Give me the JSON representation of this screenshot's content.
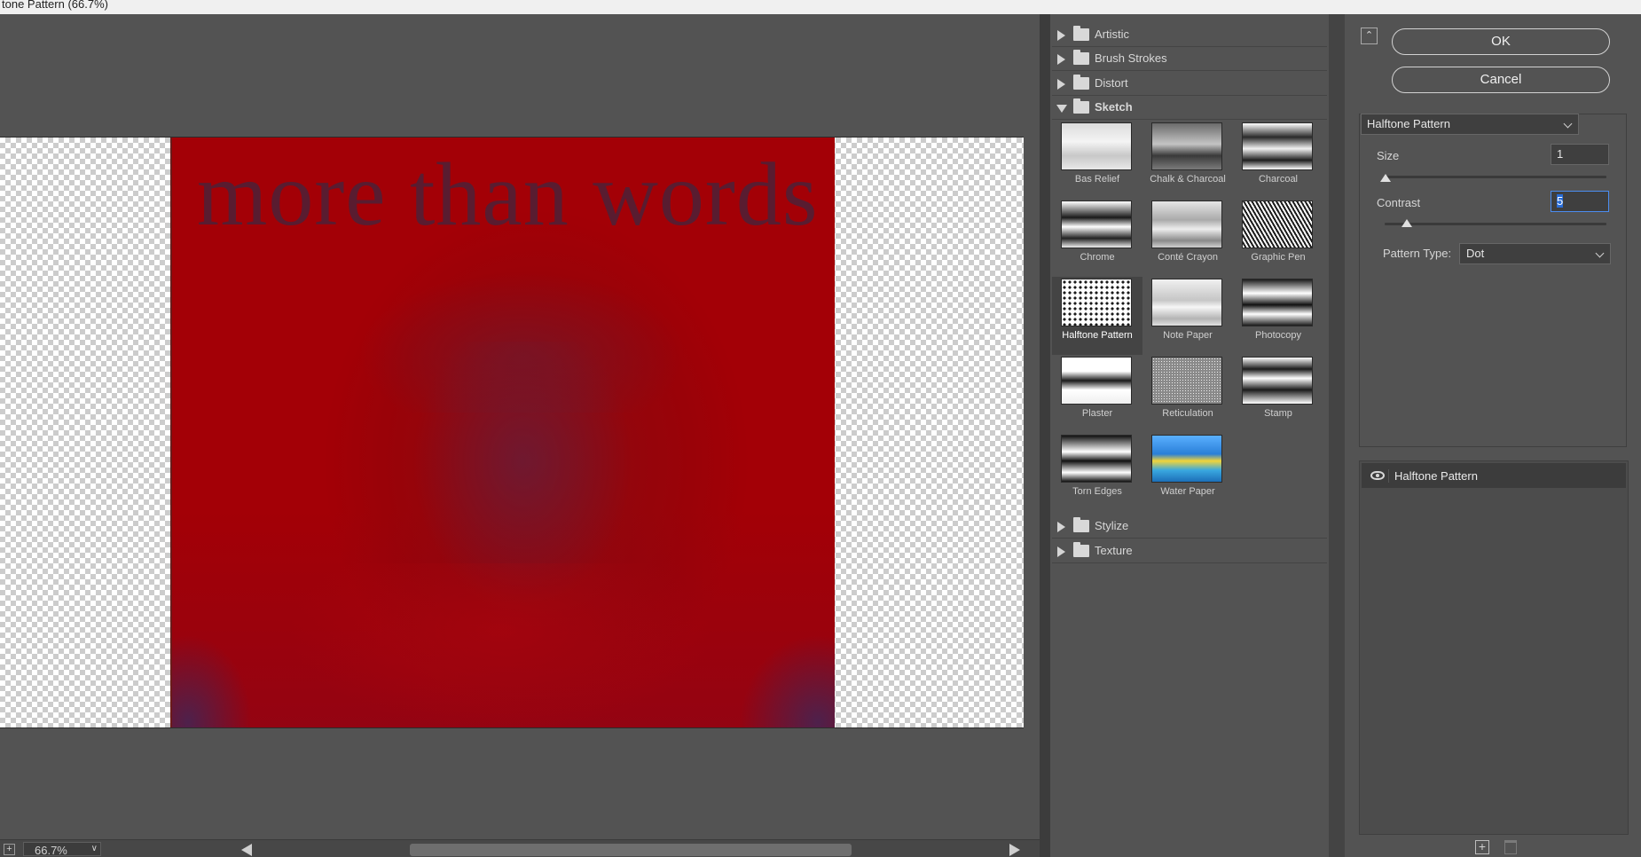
{
  "window": {
    "title": "tone Pattern (66.7%)"
  },
  "preview": {
    "artwork_text": "more than words",
    "zoom": "66.7%"
  },
  "gallery": {
    "folders_top": [
      {
        "name": "Artistic",
        "open": false
      },
      {
        "name": "Brush Strokes",
        "open": false
      },
      {
        "name": "Distort",
        "open": false
      },
      {
        "name": "Sketch",
        "open": true
      }
    ],
    "sketch_filters": [
      {
        "name": "Bas Relief",
        "selected": false
      },
      {
        "name": "Chalk & Charcoal",
        "selected": false
      },
      {
        "name": "Charcoal",
        "selected": false
      },
      {
        "name": "Chrome",
        "selected": false
      },
      {
        "name": "Conté Crayon",
        "selected": false
      },
      {
        "name": "Graphic Pen",
        "selected": false
      },
      {
        "name": "Halftone Pattern",
        "selected": true
      },
      {
        "name": "Note Paper",
        "selected": false
      },
      {
        "name": "Photocopy",
        "selected": false
      },
      {
        "name": "Plaster",
        "selected": false
      },
      {
        "name": "Reticulation",
        "selected": false
      },
      {
        "name": "Stamp",
        "selected": false
      },
      {
        "name": "Torn Edges",
        "selected": false
      },
      {
        "name": "Water Paper",
        "selected": false
      }
    ],
    "folders_bottom": [
      {
        "name": "Stylize",
        "open": false
      },
      {
        "name": "Texture",
        "open": false
      }
    ]
  },
  "settings": {
    "ok_label": "OK",
    "cancel_label": "Cancel",
    "filter_select": "Halftone Pattern",
    "size_label": "Size",
    "size_value": "1",
    "size_level": 0.0,
    "contrast_label": "Contrast",
    "contrast_value": "5",
    "contrast_level": 0.1,
    "pattern_type_label": "Pattern Type:",
    "pattern_type_value": "Dot"
  },
  "layers": {
    "items": [
      {
        "name": "Halftone Pattern",
        "visible": true
      }
    ]
  },
  "colors": {
    "artwork_red": "#a00007",
    "accent_blue": "#4b8df0",
    "panel_bg": "#535353"
  }
}
